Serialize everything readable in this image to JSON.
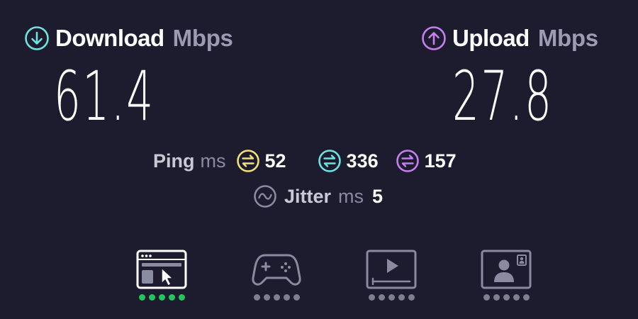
{
  "download": {
    "label": "Download",
    "unit": "Mbps",
    "value": "61.4",
    "icon": "arrow-down-circle-icon",
    "color": "#6ee3e0"
  },
  "upload": {
    "label": "Upload",
    "unit": "Mbps",
    "value": "27.8",
    "icon": "arrow-up-circle-icon",
    "color": "#c77ff0"
  },
  "ping": {
    "label": "Ping",
    "unit": "ms",
    "idle": {
      "value": "52",
      "icon": "ping-idle-icon",
      "color": "#f3e07c"
    },
    "download": {
      "value": "336",
      "icon": "ping-download-icon",
      "color": "#6ee3e0"
    },
    "upload": {
      "value": "157",
      "icon": "ping-upload-icon",
      "color": "#c77ff0"
    }
  },
  "jitter": {
    "label": "Jitter",
    "unit": "ms",
    "value": "5",
    "icon": "wave-circle-icon"
  },
  "usecases": [
    {
      "icon": "web-browsing-icon",
      "rating": 5,
      "max": 5,
      "active": true,
      "color": "#22c55e"
    },
    {
      "icon": "gaming-controller-icon",
      "rating": 0,
      "max": 5,
      "active": false,
      "color": "#7e7e90"
    },
    {
      "icon": "video-streaming-icon",
      "rating": 0,
      "max": 5,
      "active": false,
      "color": "#7e7e90"
    },
    {
      "icon": "video-call-icon",
      "rating": 0,
      "max": 5,
      "active": false,
      "color": "#7e7e90"
    }
  ],
  "colors": {
    "background": "#1c1c2e",
    "text": "#ffffff",
    "muted": "#9b9bb2",
    "inactive_icon": "#8a8aa0"
  }
}
